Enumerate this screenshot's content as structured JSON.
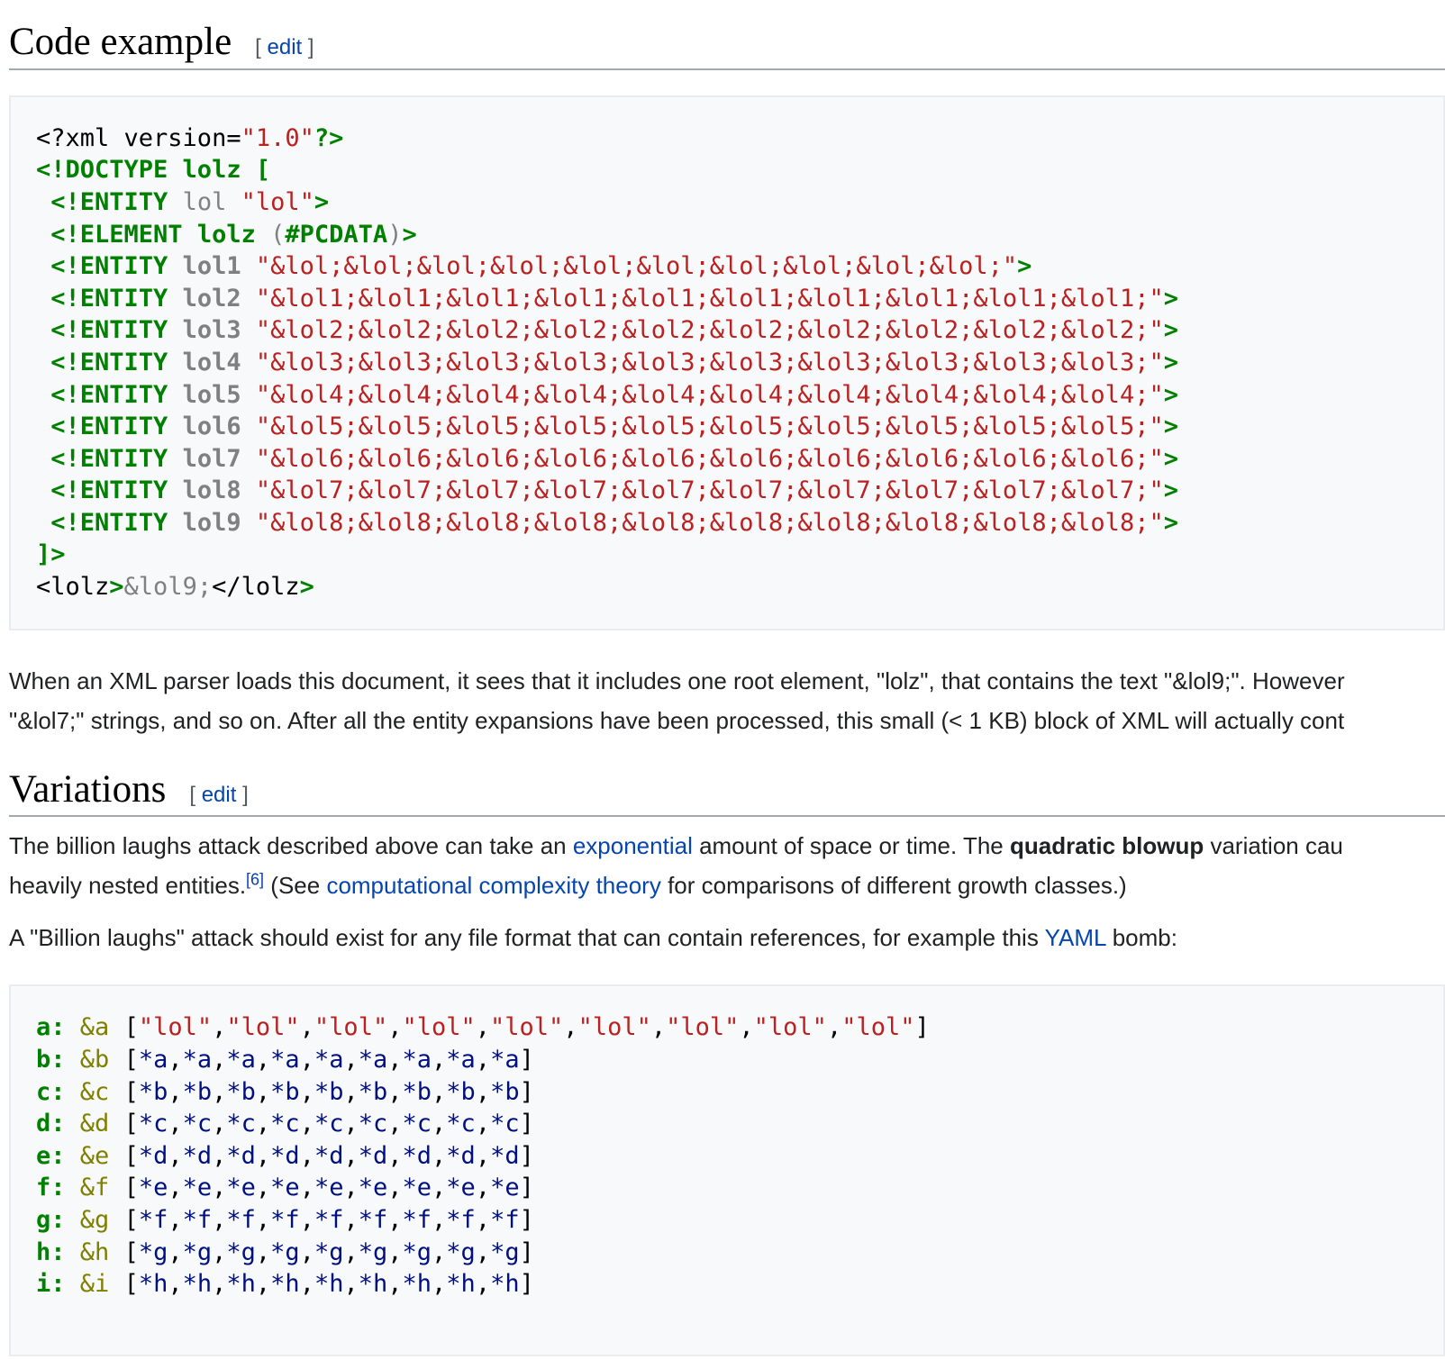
{
  "sections": {
    "code_example": {
      "title": "Code example",
      "edit_open": "[ ",
      "edit_label": "edit",
      "edit_close": " ]"
    },
    "variations": {
      "title": "Variations",
      "edit_open": "[ ",
      "edit_label": "edit",
      "edit_close": " ]"
    }
  },
  "xml": {
    "decl": {
      "open": "<?xml version=",
      "value": "\"1.0\"",
      "close": "?>"
    },
    "doctype": "<!DOCTYPE lolz [",
    "entity_kw": "<!ENTITY",
    "element_kw": "<!ELEMENT",
    "gt": ">",
    "lol": {
      "name": "lol",
      "value": "\"lol\""
    },
    "element": {
      "name": "lolz",
      "open": " (",
      "body": "#PCDATA",
      "close": ")"
    },
    "entities": [
      {
        "name": "lol1",
        "value": "\"&lol;&lol;&lol;&lol;&lol;&lol;&lol;&lol;&lol;&lol;\""
      },
      {
        "name": "lol2",
        "value": "\"&lol1;&lol1;&lol1;&lol1;&lol1;&lol1;&lol1;&lol1;&lol1;&lol1;\""
      },
      {
        "name": "lol3",
        "value": "\"&lol2;&lol2;&lol2;&lol2;&lol2;&lol2;&lol2;&lol2;&lol2;&lol2;\""
      },
      {
        "name": "lol4",
        "value": "\"&lol3;&lol3;&lol3;&lol3;&lol3;&lol3;&lol3;&lol3;&lol3;&lol3;\""
      },
      {
        "name": "lol5",
        "value": "\"&lol4;&lol4;&lol4;&lol4;&lol4;&lol4;&lol4;&lol4;&lol4;&lol4;\""
      },
      {
        "name": "lol6",
        "value": "\"&lol5;&lol5;&lol5;&lol5;&lol5;&lol5;&lol5;&lol5;&lol5;&lol5;\""
      },
      {
        "name": "lol7",
        "value": "\"&lol6;&lol6;&lol6;&lol6;&lol6;&lol6;&lol6;&lol6;&lol6;&lol6;\""
      },
      {
        "name": "lol8",
        "value": "\"&lol7;&lol7;&lol7;&lol7;&lol7;&lol7;&lol7;&lol7;&lol7;&lol7;\""
      },
      {
        "name": "lol9",
        "value": "\"&lol8;&lol8;&lol8;&lol8;&lol8;&lol8;&lol8;&lol8;&lol8;&lol8;\""
      }
    ],
    "doctype_close": "]>",
    "root": {
      "open": "<lolz",
      "gt": ">",
      "text": "&lol9;",
      "close": "</lolz",
      "close_gt": ">"
    }
  },
  "para1": {
    "line1": "When an XML parser loads this document, it sees that it includes one root element, \"lolz\", that contains the text \"&lol9;\". However",
    "line2": "\"&lol7;\" strings, and so on. After all the entity expansions have been processed, this small (< 1 KB) block of XML will actually cont"
  },
  "para2": {
    "t1": "The billion laughs attack described above can take an ",
    "link1": "exponential",
    "t2": " amount of space or time. The ",
    "bold": "quadratic blowup",
    "t3": " variation cau",
    "t4": "heavily nested entities.",
    "sup": "[6]",
    "t5": " (See ",
    "link2": "computational complexity theory",
    "t6": " for comparisons of different growth classes.)"
  },
  "para3": {
    "t1": "A \"Billion laughs\" attack should exist for any file format that can contain references, for example this ",
    "link": "YAML",
    "t2": " bomb:"
  },
  "yaml": [
    {
      "key": "a:",
      "anchor": "&a",
      "open": "[",
      "items": [
        "\"lol\"",
        "\"lol\"",
        "\"lol\"",
        "\"lol\"",
        "\"lol\"",
        "\"lol\"",
        "\"lol\"",
        "\"lol\"",
        "\"lol\""
      ],
      "close": "]",
      "strings": true
    },
    {
      "key": "b:",
      "anchor": "&b",
      "open": "[",
      "items": [
        "*a",
        "*a",
        "*a",
        "*a",
        "*a",
        "*a",
        "*a",
        "*a",
        "*a"
      ],
      "close": "]"
    },
    {
      "key": "c:",
      "anchor": "&c",
      "open": "[",
      "items": [
        "*b",
        "*b",
        "*b",
        "*b",
        "*b",
        "*b",
        "*b",
        "*b",
        "*b"
      ],
      "close": "]"
    },
    {
      "key": "d:",
      "anchor": "&d",
      "open": "[",
      "items": [
        "*c",
        "*c",
        "*c",
        "*c",
        "*c",
        "*c",
        "*c",
        "*c",
        "*c"
      ],
      "close": "]"
    },
    {
      "key": "e:",
      "anchor": "&e",
      "open": "[",
      "items": [
        "*d",
        "*d",
        "*d",
        "*d",
        "*d",
        "*d",
        "*d",
        "*d",
        "*d"
      ],
      "close": "]"
    },
    {
      "key": "f:",
      "anchor": "&f",
      "open": "[",
      "items": [
        "*e",
        "*e",
        "*e",
        "*e",
        "*e",
        "*e",
        "*e",
        "*e",
        "*e"
      ],
      "close": "]"
    },
    {
      "key": "g:",
      "anchor": "&g",
      "open": "[",
      "items": [
        "*f",
        "*f",
        "*f",
        "*f",
        "*f",
        "*f",
        "*f",
        "*f",
        "*f"
      ],
      "close": "]"
    },
    {
      "key": "h:",
      "anchor": "&h",
      "open": "[",
      "items": [
        "*g",
        "*g",
        "*g",
        "*g",
        "*g",
        "*g",
        "*g",
        "*g",
        "*g"
      ],
      "close": "]"
    },
    {
      "key": "i:",
      "anchor": "&i",
      "open": "[",
      "items": [
        "*h",
        "*h",
        "*h",
        "*h",
        "*h",
        "*h",
        "*h",
        "*h",
        "*h"
      ],
      "close": "]"
    }
  ]
}
